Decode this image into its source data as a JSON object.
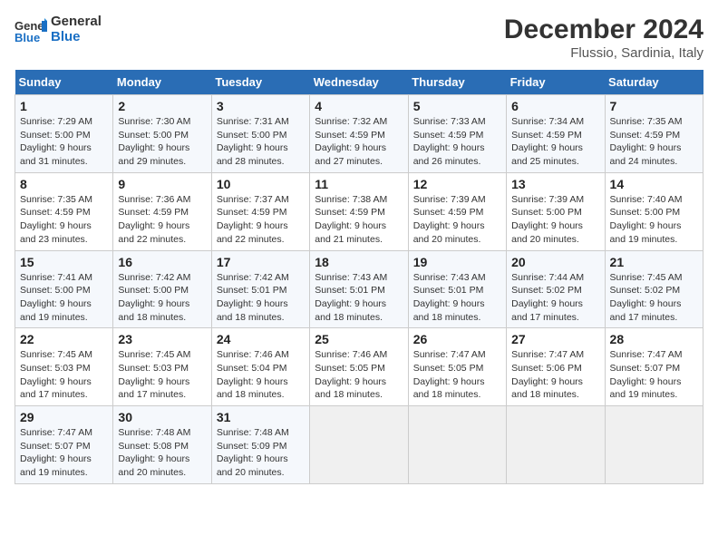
{
  "logo": {
    "line1": "General",
    "line2": "Blue"
  },
  "title": "December 2024",
  "subtitle": "Flussio, Sardinia, Italy",
  "header": {
    "days": [
      "Sunday",
      "Monday",
      "Tuesday",
      "Wednesday",
      "Thursday",
      "Friday",
      "Saturday"
    ]
  },
  "weeks": [
    [
      {
        "day": "1",
        "detail": "Sunrise: 7:29 AM\nSunset: 5:00 PM\nDaylight: 9 hours\nand 31 minutes."
      },
      {
        "day": "2",
        "detail": "Sunrise: 7:30 AM\nSunset: 5:00 PM\nDaylight: 9 hours\nand 29 minutes."
      },
      {
        "day": "3",
        "detail": "Sunrise: 7:31 AM\nSunset: 5:00 PM\nDaylight: 9 hours\nand 28 minutes."
      },
      {
        "day": "4",
        "detail": "Sunrise: 7:32 AM\nSunset: 4:59 PM\nDaylight: 9 hours\nand 27 minutes."
      },
      {
        "day": "5",
        "detail": "Sunrise: 7:33 AM\nSunset: 4:59 PM\nDaylight: 9 hours\nand 26 minutes."
      },
      {
        "day": "6",
        "detail": "Sunrise: 7:34 AM\nSunset: 4:59 PM\nDaylight: 9 hours\nand 25 minutes."
      },
      {
        "day": "7",
        "detail": "Sunrise: 7:35 AM\nSunset: 4:59 PM\nDaylight: 9 hours\nand 24 minutes."
      }
    ],
    [
      {
        "day": "8",
        "detail": "Sunrise: 7:35 AM\nSunset: 4:59 PM\nDaylight: 9 hours\nand 23 minutes."
      },
      {
        "day": "9",
        "detail": "Sunrise: 7:36 AM\nSunset: 4:59 PM\nDaylight: 9 hours\nand 22 minutes."
      },
      {
        "day": "10",
        "detail": "Sunrise: 7:37 AM\nSunset: 4:59 PM\nDaylight: 9 hours\nand 22 minutes."
      },
      {
        "day": "11",
        "detail": "Sunrise: 7:38 AM\nSunset: 4:59 PM\nDaylight: 9 hours\nand 21 minutes."
      },
      {
        "day": "12",
        "detail": "Sunrise: 7:39 AM\nSunset: 4:59 PM\nDaylight: 9 hours\nand 20 minutes."
      },
      {
        "day": "13",
        "detail": "Sunrise: 7:39 AM\nSunset: 5:00 PM\nDaylight: 9 hours\nand 20 minutes."
      },
      {
        "day": "14",
        "detail": "Sunrise: 7:40 AM\nSunset: 5:00 PM\nDaylight: 9 hours\nand 19 minutes."
      }
    ],
    [
      {
        "day": "15",
        "detail": "Sunrise: 7:41 AM\nSunset: 5:00 PM\nDaylight: 9 hours\nand 19 minutes."
      },
      {
        "day": "16",
        "detail": "Sunrise: 7:42 AM\nSunset: 5:00 PM\nDaylight: 9 hours\nand 18 minutes."
      },
      {
        "day": "17",
        "detail": "Sunrise: 7:42 AM\nSunset: 5:01 PM\nDaylight: 9 hours\nand 18 minutes."
      },
      {
        "day": "18",
        "detail": "Sunrise: 7:43 AM\nSunset: 5:01 PM\nDaylight: 9 hours\nand 18 minutes."
      },
      {
        "day": "19",
        "detail": "Sunrise: 7:43 AM\nSunset: 5:01 PM\nDaylight: 9 hours\nand 18 minutes."
      },
      {
        "day": "20",
        "detail": "Sunrise: 7:44 AM\nSunset: 5:02 PM\nDaylight: 9 hours\nand 17 minutes."
      },
      {
        "day": "21",
        "detail": "Sunrise: 7:45 AM\nSunset: 5:02 PM\nDaylight: 9 hours\nand 17 minutes."
      }
    ],
    [
      {
        "day": "22",
        "detail": "Sunrise: 7:45 AM\nSunset: 5:03 PM\nDaylight: 9 hours\nand 17 minutes."
      },
      {
        "day": "23",
        "detail": "Sunrise: 7:45 AM\nSunset: 5:03 PM\nDaylight: 9 hours\nand 17 minutes."
      },
      {
        "day": "24",
        "detail": "Sunrise: 7:46 AM\nSunset: 5:04 PM\nDaylight: 9 hours\nand 18 minutes."
      },
      {
        "day": "25",
        "detail": "Sunrise: 7:46 AM\nSunset: 5:05 PM\nDaylight: 9 hours\nand 18 minutes."
      },
      {
        "day": "26",
        "detail": "Sunrise: 7:47 AM\nSunset: 5:05 PM\nDaylight: 9 hours\nand 18 minutes."
      },
      {
        "day": "27",
        "detail": "Sunrise: 7:47 AM\nSunset: 5:06 PM\nDaylight: 9 hours\nand 18 minutes."
      },
      {
        "day": "28",
        "detail": "Sunrise: 7:47 AM\nSunset: 5:07 PM\nDaylight: 9 hours\nand 19 minutes."
      }
    ],
    [
      {
        "day": "29",
        "detail": "Sunrise: 7:47 AM\nSunset: 5:07 PM\nDaylight: 9 hours\nand 19 minutes."
      },
      {
        "day": "30",
        "detail": "Sunrise: 7:48 AM\nSunset: 5:08 PM\nDaylight: 9 hours\nand 20 minutes."
      },
      {
        "day": "31",
        "detail": "Sunrise: 7:48 AM\nSunset: 5:09 PM\nDaylight: 9 hours\nand 20 minutes."
      },
      {
        "day": "",
        "detail": ""
      },
      {
        "day": "",
        "detail": ""
      },
      {
        "day": "",
        "detail": ""
      },
      {
        "day": "",
        "detail": ""
      }
    ]
  ],
  "colors": {
    "header_bg": "#2a6db5",
    "header_text": "#ffffff",
    "accent": "#1a6fc4"
  }
}
